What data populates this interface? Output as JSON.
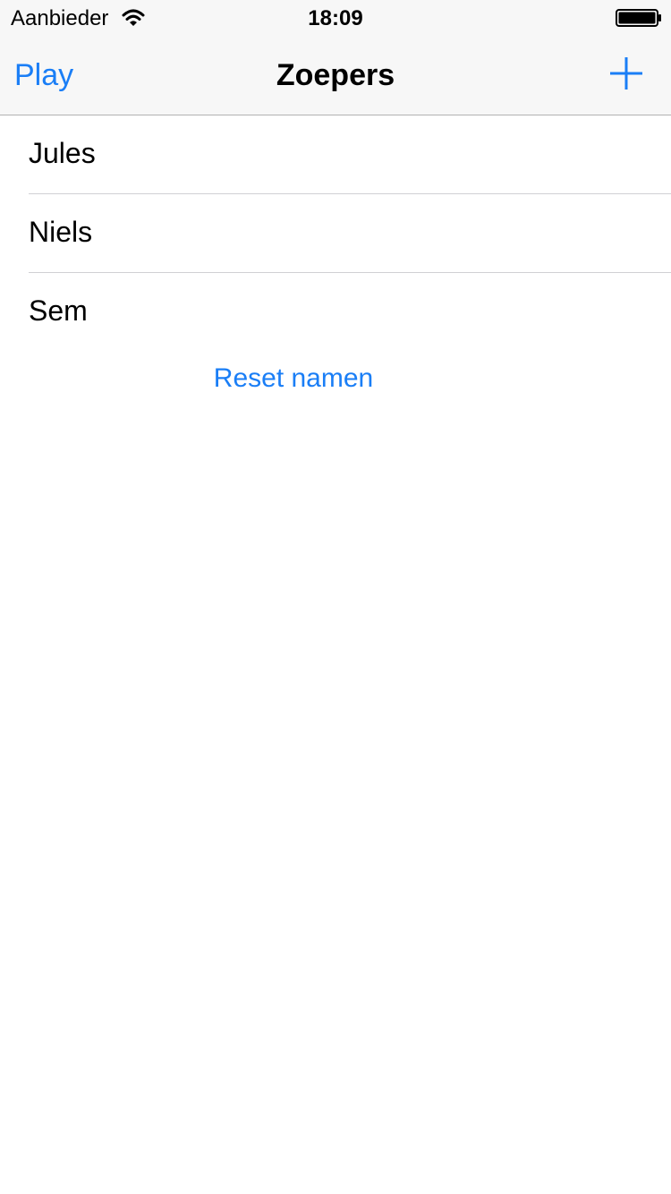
{
  "status_bar": {
    "carrier": "Aanbieder",
    "time": "18:09",
    "wifi_icon": "wifi-icon",
    "battery_icon": "battery-icon"
  },
  "nav": {
    "left_label": "Play",
    "title": "Zoepers",
    "right_icon": "plus-icon"
  },
  "players": [
    {
      "name": "Jules"
    },
    {
      "name": "Niels"
    },
    {
      "name": "Sem"
    }
  ],
  "reset_label": "Reset namen",
  "colors": {
    "accent": "#1a7ef6",
    "bar_background": "#f7f7f7",
    "separator": "#d0d0d4"
  }
}
